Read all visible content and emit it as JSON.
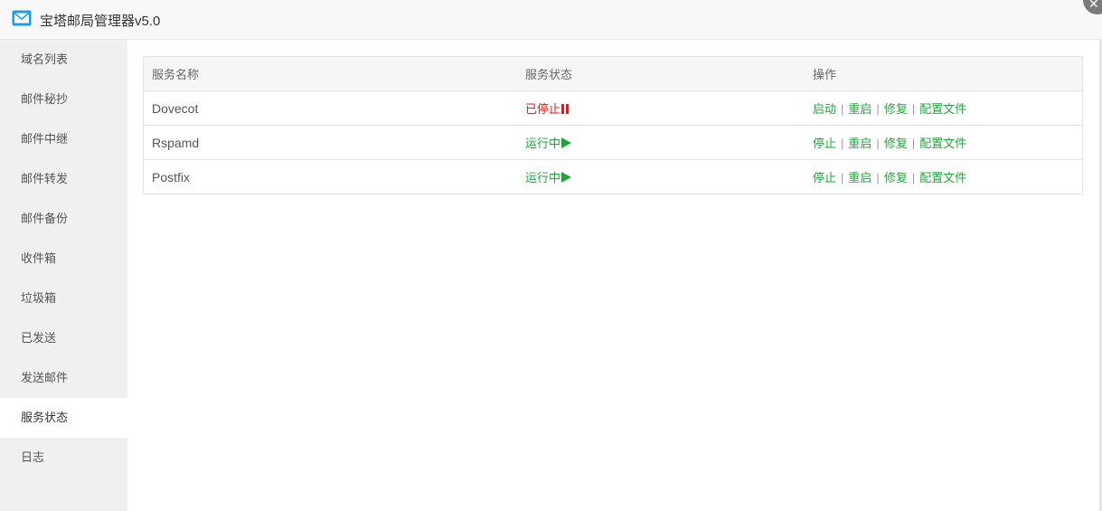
{
  "window": {
    "title": "宝塔邮局管理器v5.0",
    "icon": "mail-icon",
    "accent_color": "#20a53a"
  },
  "sidebar": {
    "items": [
      {
        "label": "域名列表"
      },
      {
        "label": "邮件秘抄"
      },
      {
        "label": "邮件中继"
      },
      {
        "label": "邮件转发"
      },
      {
        "label": "邮件备份"
      },
      {
        "label": "收件箱"
      },
      {
        "label": "垃圾箱"
      },
      {
        "label": "已发送"
      },
      {
        "label": "发送邮件"
      },
      {
        "label": "服务状态",
        "active": true
      },
      {
        "label": "日志"
      }
    ]
  },
  "table": {
    "headers": {
      "name": "服务名称",
      "status": "服务状态",
      "ops": "操作"
    },
    "separator": "|",
    "rows": [
      {
        "name": "Dovecot",
        "status": "已停止",
        "status_kind": "stopped",
        "status_icon": "pause-icon",
        "actions": [
          "启动",
          "重启",
          "修复",
          "配置文件"
        ]
      },
      {
        "name": "Rspamd",
        "status": "运行中",
        "status_kind": "running",
        "status_icon": "play-icon",
        "actions": [
          "停止",
          "重启",
          "修复",
          "配置文件"
        ]
      },
      {
        "name": "Postfix",
        "status": "运行中",
        "status_kind": "running",
        "status_icon": "play-icon",
        "actions": [
          "停止",
          "重启",
          "修复",
          "配置文件"
        ]
      }
    ]
  },
  "colors": {
    "running": "#20a53a",
    "stopped": "#e01b1b"
  }
}
